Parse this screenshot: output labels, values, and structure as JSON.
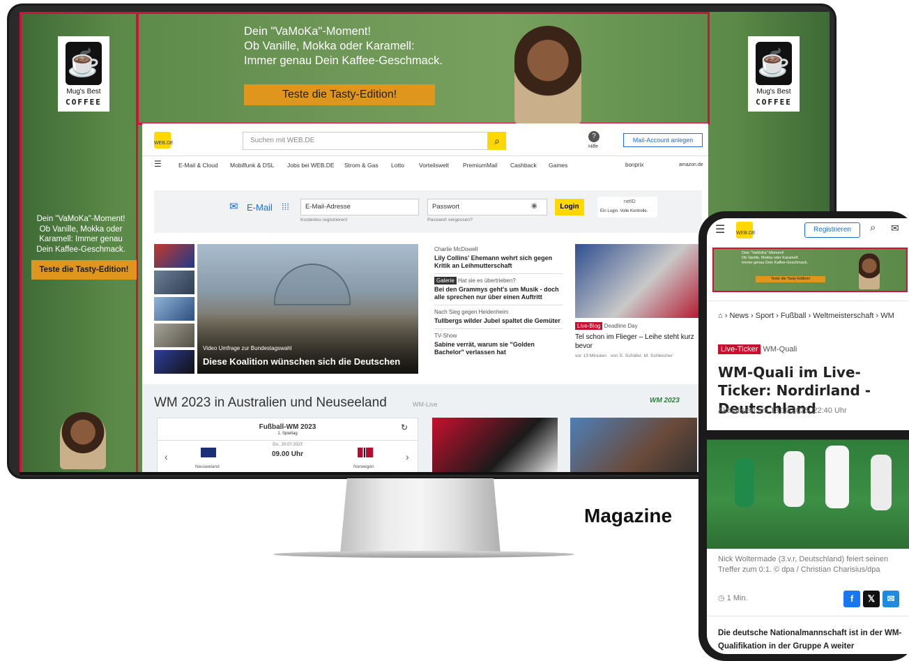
{
  "banner": {
    "headline_1": "Dein \"VaMoKa\"-Moment!",
    "headline_2": "Ob Vanille, Mokka oder Karamell:",
    "headline_3": "Immer genau Dein Kaffee-Geschmack.",
    "cta": "Teste die Tasty-Edition!"
  },
  "brand": {
    "line1": "Mug's Best",
    "line2": "COFFEE"
  },
  "sidebar_ad": {
    "text": "Dein \"VaMoKa\"-Moment! Ob Vanille, Mokka oder Karamell: Immer genau Dein Kaffee-Geschmack.",
    "cta": "Teste die Tasty-Edition!"
  },
  "webde": {
    "logo": "WEB.DE",
    "search_placeholder": "Suchen mit WEB.DE",
    "help": "Hilfe",
    "create_account": "Mail-Account anlegen",
    "nav": [
      "E-Mail & Cloud",
      "Mobilfunk & DSL",
      "Jobs bei WEB.DE",
      "Strom & Gas",
      "Lotto",
      "Vorteilswelt",
      "PremiumMail",
      "Cashback",
      "Games"
    ],
    "nav_right": [
      "bonprix",
      "amazon.de"
    ],
    "login": {
      "email_label": "E-Mail",
      "email_placeholder": "E-Mail-Adresse",
      "password_placeholder": "Passwort",
      "login_btn": "Login",
      "register": "Kostenlos registrieren!",
      "forgot": "Passwort vergessen?",
      "netid": "netID",
      "netid_slogan": "Ein Login. Volle Kontrolle."
    },
    "hero": {
      "video_label": "Video",
      "kicker": "Umfrage zur Bundestagswahl",
      "title": "Diese Koalition wünschen sich die Deutschen"
    },
    "stories": [
      {
        "kicker": "Charlie McDowell",
        "title": "Lily Collins' Ehemann wehrt sich gegen Kritik an Leihmutterschaft"
      },
      {
        "tag": "Galerie",
        "kicker": "Hat sie es übertrieben?",
        "title": "Bei den Grammys geht's um Musik - doch alle sprechen nur über einen Auftritt"
      },
      {
        "kicker": "Nach Sieg gegen Heidenheim",
        "title": "Tullbergs wilder Jubel spaltet die Gemüter"
      },
      {
        "kicker": "TV-Show",
        "title": "Sabine verrät, warum sie \"Golden Bachelor\" verlassen hat"
      }
    ],
    "side_story": {
      "tag": "Live-Blog",
      "kicker": "Deadline Day",
      "title": "Tel schon im Flieger – Leihe steht kurz bevor",
      "time": "vor 13 Minuten",
      "author": "von S. Schäfer, M. Schleicher"
    },
    "wm": {
      "title": "WM 2023 in Australien und Neuseeland",
      "subtitle": "WM-Live",
      "badge": "WM 2023",
      "widget_title": "Fußball-WM 2023",
      "widget_sub": "1. Spieltag",
      "date": "Do., 20.07.2023",
      "time": "09.00 Uhr",
      "home": "Neuseeland",
      "away": "Norwegen"
    }
  },
  "mobile": {
    "register": "Registrieren",
    "breadcrumb": [
      "News",
      "Sport",
      "Fußball",
      "Weltmeisterschaft",
      "WM"
    ],
    "tag": "Live-Ticker",
    "tag_label": "WM-Quali",
    "title": "WM-Quali im Live-Ticker: Nordirland - Deutschland",
    "updated": "Aktualisiert am 13.10.2025, 22:40 Uhr",
    "caption": "Nick Woltermade (3.v.r, Deutschland) feiert seinen Treffer zum 0:1. © dpa / Christian Charisius/dpa",
    "read_time": "1 Min.",
    "body": "Die deutsche Nationalmannschaft ist in der WM-Qualifikation in der Gruppe A weiter"
  },
  "label": "Magazine",
  "colors": {
    "accent": "#d1103b",
    "webde_yellow": "#ffd800",
    "cta_orange": "#e0961c",
    "ad_green": "#5b8a48"
  }
}
